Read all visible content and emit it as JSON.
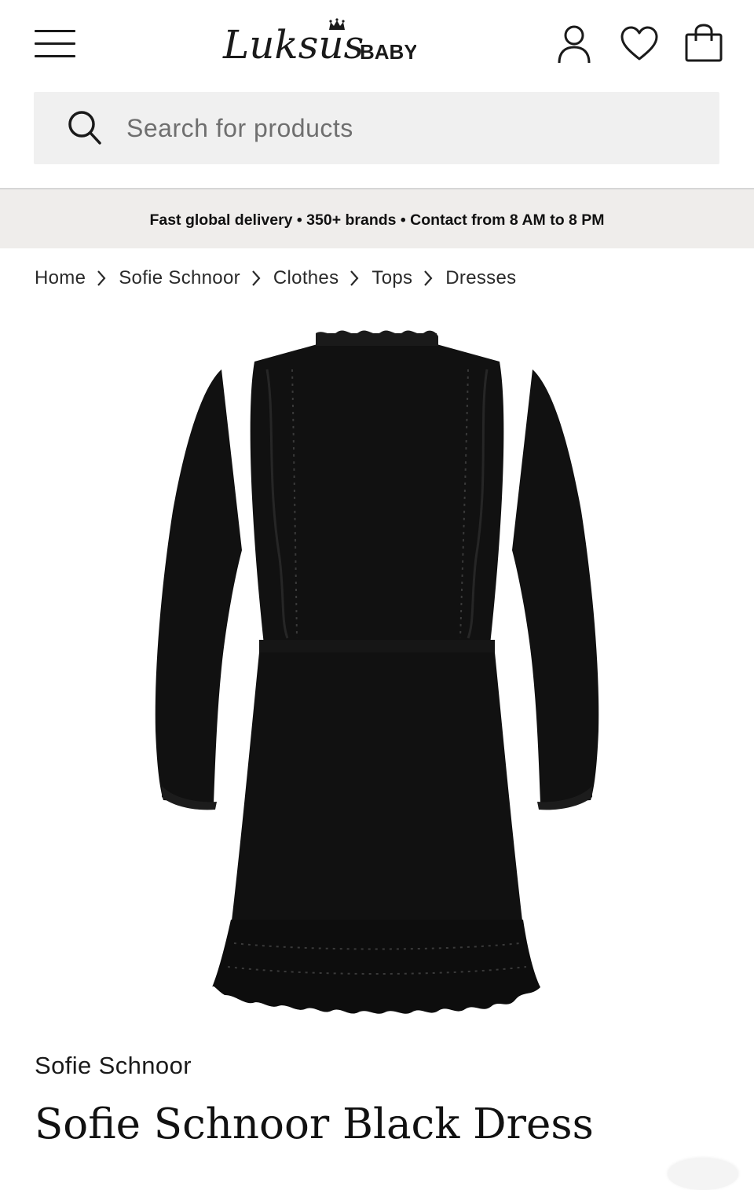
{
  "header": {
    "logo_script": "Luksus",
    "logo_suffix": "BABY"
  },
  "search": {
    "placeholder": "Search for products",
    "value": ""
  },
  "promo": {
    "text": "Fast global delivery • 350+ brands • Contact from 8 AM to 8 PM"
  },
  "breadcrumb": {
    "items": [
      "Home",
      "Sofie Schnoor",
      "Clothes",
      "Tops",
      "Dresses"
    ]
  },
  "product": {
    "brand": "Sofie Schnoor",
    "title": "Sofie Schnoor Black Dress",
    "image_alt": "black long sleeve dress with ruffles and lace hem"
  },
  "colors": {
    "text": "#1a1a1a",
    "search_bg": "#f0f0f0",
    "promo_bg": "#efedeb",
    "dress": "#111111"
  },
  "icons": {
    "menu": "hamburger-menu-icon",
    "account": "user-icon",
    "wishlist": "heart-icon",
    "cart": "shopping-bag-icon",
    "search": "search-icon",
    "breadcrumb_separator": "chevron-right-icon"
  }
}
